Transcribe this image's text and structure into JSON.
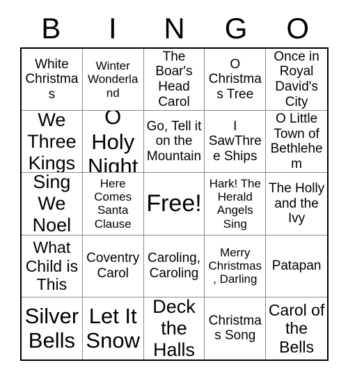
{
  "card": {
    "header_letters": [
      "B",
      "I",
      "N",
      "G",
      "O"
    ],
    "rows": [
      [
        {
          "text": "White Christmas",
          "size": "m"
        },
        {
          "text": "Winter Wonderland",
          "size": "s"
        },
        {
          "text": "The Boar's Head Carol",
          "size": "m"
        },
        {
          "text": "O Christmas Tree",
          "size": "m"
        },
        {
          "text": "Once in Royal David's City",
          "size": "m"
        }
      ],
      [
        {
          "text": "We Three Kings",
          "size": "xl"
        },
        {
          "text": "O Holy Night",
          "size": "xxl"
        },
        {
          "text": "Go, Tell it on the Mountain",
          "size": "m"
        },
        {
          "text": "I SawThree Ships",
          "size": "m"
        },
        {
          "text": "O Little Town of Bethlehem",
          "size": "m"
        }
      ],
      [
        {
          "text": "Sing We Noel",
          "size": "xl"
        },
        {
          "text": "Here Comes Santa Clause",
          "size": "s"
        },
        {
          "text": "Free!",
          "size": "free"
        },
        {
          "text": "Hark! The Herald Angels Sing",
          "size": "s"
        },
        {
          "text": "The Holly and the Ivy",
          "size": "m"
        }
      ],
      [
        {
          "text": "What Child is This",
          "size": "l"
        },
        {
          "text": "Coventry Carol",
          "size": "m"
        },
        {
          "text": "Caroling, Caroling",
          "size": "m"
        },
        {
          "text": "Merry Christmas, Darling",
          "size": "s"
        },
        {
          "text": "Patapan",
          "size": "m"
        }
      ],
      [
        {
          "text": "Silver Bells",
          "size": "xxl"
        },
        {
          "text": "Let It Snow",
          "size": "xxl"
        },
        {
          "text": "Deck the Halls",
          "size": "xl"
        },
        {
          "text": "Christmas Song",
          "size": "m"
        },
        {
          "text": "Carol of the Bells",
          "size": "l"
        }
      ]
    ]
  },
  "colors": {
    "background": "#ffffff",
    "text": "#000000",
    "grid_border": "#000000",
    "grid_line": "#8a8a8a"
  }
}
